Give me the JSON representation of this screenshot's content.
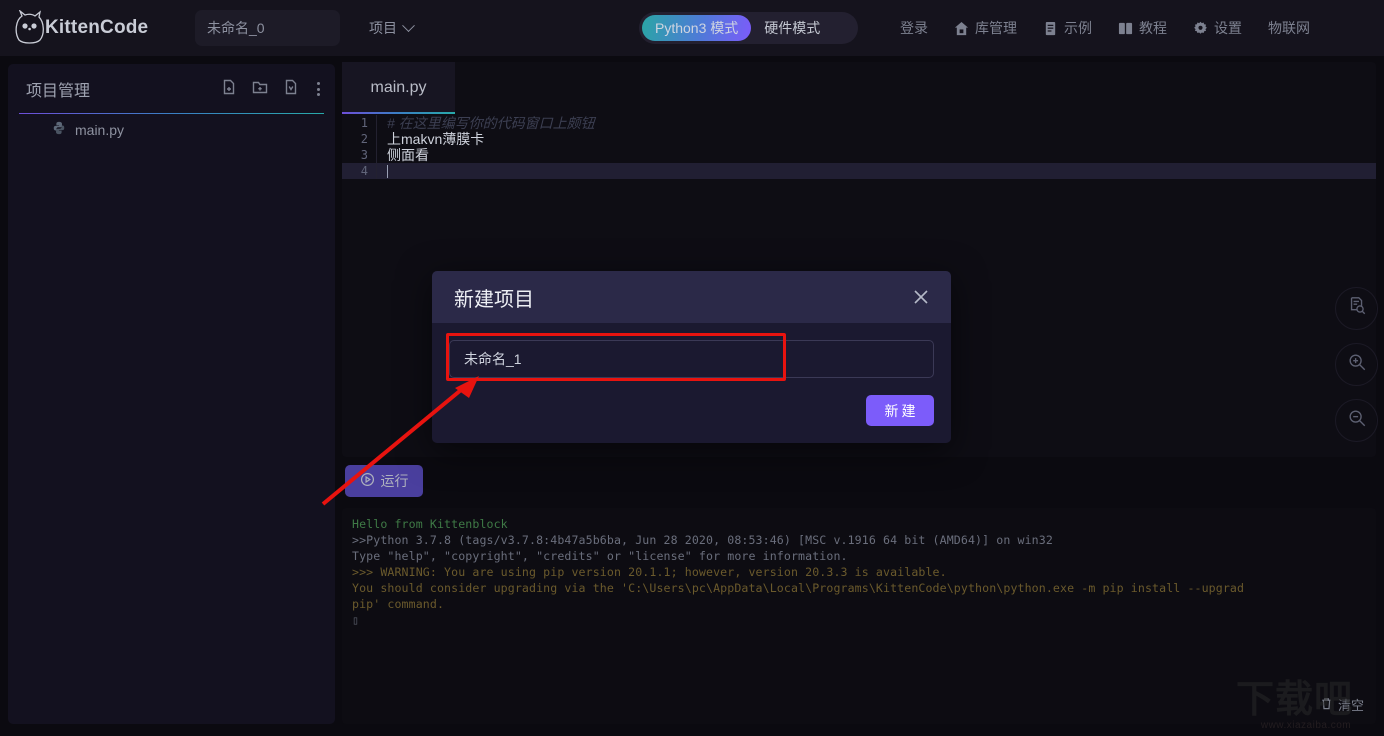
{
  "header": {
    "brand": "KittenCode",
    "logo_icon": "cat-logo-icon",
    "project_name_value": "未命名_0",
    "project_menu_label": "项目",
    "chevron_icon": "chevron-down-icon",
    "modes": [
      {
        "label": "Python3 模式",
        "active": true
      },
      {
        "label": "硬件模式",
        "active": false
      }
    ],
    "nav": [
      {
        "label": "登录",
        "icon": ""
      },
      {
        "label": "库管理",
        "icon": "home-icon"
      },
      {
        "label": "示例",
        "icon": "document-icon"
      },
      {
        "label": "教程",
        "icon": "book-icon"
      },
      {
        "label": "设置",
        "icon": "gear-icon"
      },
      {
        "label": "物联网",
        "icon": ""
      }
    ]
  },
  "sidebar": {
    "title": "项目管理",
    "actions": [
      {
        "name": "new-file-icon",
        "title": "新建文件"
      },
      {
        "name": "new-folder-icon",
        "title": "新建文件夹"
      },
      {
        "name": "import-file-icon",
        "title": "导入文件"
      },
      {
        "name": "more-menu-icon",
        "title": "更多"
      }
    ],
    "files": [
      {
        "name": "main.py",
        "icon": "python-file-icon"
      }
    ]
  },
  "editor": {
    "tabs": [
      {
        "label": "main.py",
        "active": true
      }
    ],
    "lines": [
      {
        "no": "1",
        "text": "# 在这里编写你的代码窗口上颇钮",
        "comment": true,
        "active": false
      },
      {
        "no": "2",
        "text": "上makvn薄膜卡",
        "comment": false,
        "active": false
      },
      {
        "no": "3",
        "text": "侧面看",
        "comment": false,
        "active": false
      },
      {
        "no": "4",
        "text": "",
        "comment": false,
        "active": true
      }
    ],
    "tools": [
      {
        "name": "find-in-file-icon",
        "title": "查找"
      },
      {
        "name": "zoom-in-icon",
        "title": "放大"
      },
      {
        "name": "zoom-out-icon",
        "title": "缩小"
      }
    ]
  },
  "run": {
    "label": "运行",
    "icon": "play-circle-icon"
  },
  "console": {
    "lines": [
      {
        "text": "Hello from Kittenblock",
        "color": "green"
      },
      {
        "text": ">>Python 3.7.8 (tags/v3.7.8:4b47a5b6ba, Jun 28 2020, 08:53:46) [MSC v.1916 64 bit (AMD64)] on win32",
        "color": "grey"
      },
      {
        "text": "Type \"help\", \"copyright\", \"credits\" or \"license\" for more information.",
        "color": "grey"
      },
      {
        "text": ">>> WARNING: You are using pip version 20.1.1; however, version 20.3.3 is available.",
        "color": "warn"
      },
      {
        "text": "You should consider upgrading via the 'C:\\Users\\pc\\AppData\\Local\\Programs\\KittenCode\\python\\python.exe -m pip install --upgrad",
        "color": "warn"
      },
      {
        "text": "pip' command.",
        "color": "warn"
      },
      {
        "text": "▯",
        "color": "cursor"
      }
    ],
    "clear_label": "清空",
    "clear_icon": "trash-icon"
  },
  "modal": {
    "title": "新建项目",
    "close_icon": "close-icon",
    "input_value": "未命名_1",
    "input_placeholder": "",
    "create_label": "新建"
  },
  "annotations": {
    "highlight_rect_color": "#e8130f",
    "arrow_color": "#e8130f"
  },
  "watermark": {
    "big": "下载吧",
    "small": "www.xiazaiba.com"
  },
  "colors": {
    "accent_purple": "#7c5cfa",
    "gradient_start": "#6d4fd8",
    "gradient_mid": "#3a7fc4",
    "gradient_end": "#28a9a9",
    "page_bg": "#0b0a10",
    "header_bg": "#15131d",
    "sidebar_bg": "#13111f",
    "editor_bg": "#0e0d14",
    "modal_head_bg": "#2b2948",
    "modal_body_bg": "#1b1930"
  }
}
